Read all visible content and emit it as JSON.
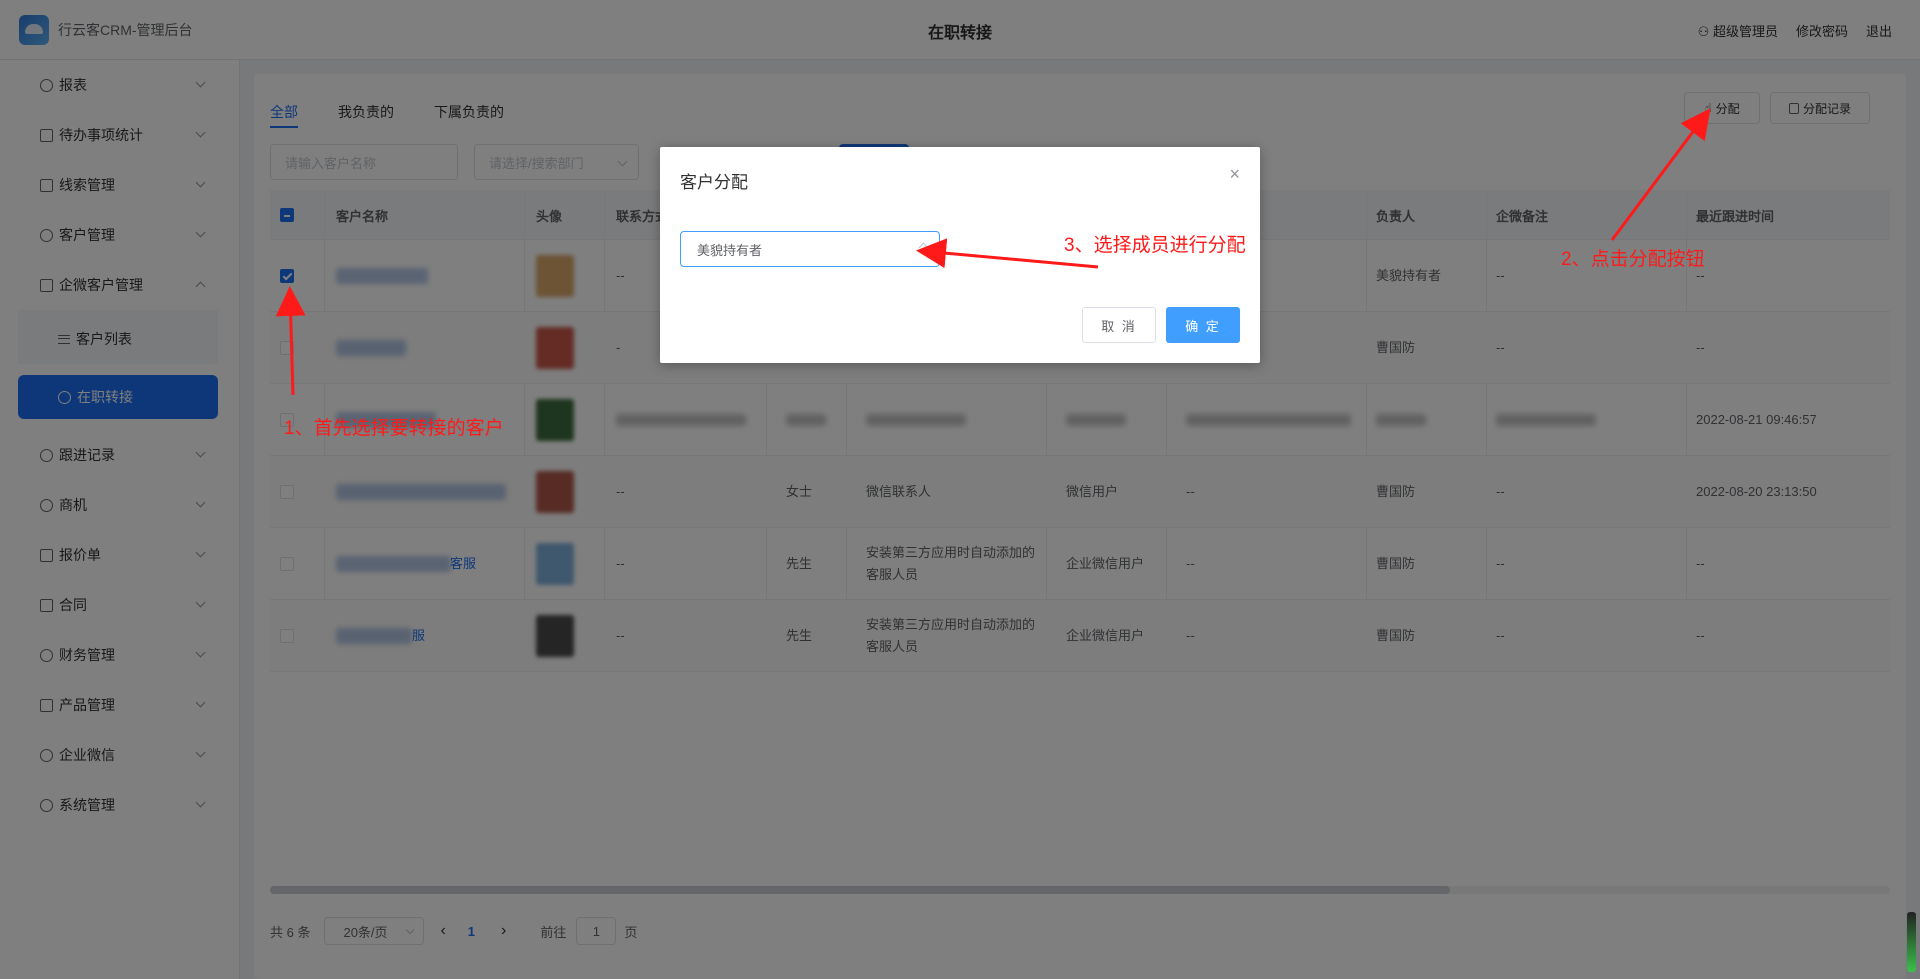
{
  "header": {
    "app_title": "行云客CRM-管理后台",
    "page_title": "在职转接",
    "user_label": "超级管理员",
    "change_password": "修改密码",
    "logout": "退出"
  },
  "sidebar": {
    "items": [
      {
        "label": "报表"
      },
      {
        "label": "待办事项统计"
      },
      {
        "label": "线索管理"
      },
      {
        "label": "客户管理"
      },
      {
        "label": "企微客户管理"
      },
      {
        "label": "跟进记录"
      },
      {
        "label": "商机"
      },
      {
        "label": "报价单"
      },
      {
        "label": "合同"
      },
      {
        "label": "财务管理"
      },
      {
        "label": "产品管理"
      },
      {
        "label": "企业微信"
      },
      {
        "label": "系统管理"
      }
    ],
    "sub_items": [
      {
        "label": "客户列表"
      },
      {
        "label": "在职转接"
      }
    ]
  },
  "tabs": [
    {
      "label": "全部"
    },
    {
      "label": "我负责的"
    },
    {
      "label": "下属负责的"
    }
  ],
  "toolbar": {
    "assign_label": "分配",
    "assign_records_label": "分配记录"
  },
  "filters": {
    "customer_name_placeholder": "请输入客户名称",
    "department_placeholder": "请选择/搜索部门"
  },
  "table": {
    "headers": [
      "客户名称",
      "头像",
      "联系方式",
      "负责人",
      "企微备注",
      "最近跟进时间"
    ],
    "rows": [
      {
        "checked": true,
        "contact": "--",
        "gender": "",
        "source": "",
        "type": "",
        "remark": "",
        "owner": "美貌持有者",
        "note": "--",
        "last_follow": "--"
      },
      {
        "checked": false,
        "contact": "-",
        "gender": "",
        "source": "",
        "type": "",
        "remark": "",
        "owner": "曹国防",
        "note": "--",
        "last_follow": "--"
      },
      {
        "checked": false,
        "contact": "",
        "gender": "",
        "source": "",
        "type": "",
        "remark": "",
        "owner": "",
        "note": "",
        "last_follow": "2022-08-21 09:46:57"
      },
      {
        "checked": false,
        "contact": "--",
        "gender": "女士",
        "source": "微信联系人",
        "type": "微信用户",
        "remark": "--",
        "owner": "曹国防",
        "note": "--",
        "last_follow": "2022-08-20 23:13:50"
      },
      {
        "checked": false,
        "contact": "--",
        "gender": "先生",
        "source": "安装第三方应用时自动添加的客服人员",
        "type": "企业微信用户",
        "remark": "--",
        "owner": "曹国防",
        "note": "--",
        "last_follow": "--"
      },
      {
        "checked": false,
        "contact": "--",
        "gender": "先生",
        "source": "安装第三方应用时自动添加的客服人员",
        "type": "企业微信用户",
        "remark": "--",
        "owner": "曹国防",
        "note": "--",
        "last_follow": "--"
      }
    ],
    "name_suffix_row5": "客服",
    "name_suffix_row6": "服"
  },
  "pagination": {
    "total": "共 6 条",
    "page_size": "20条/页",
    "prev": "‹",
    "current": "1",
    "next": "›",
    "goto_label": "前往",
    "goto_value": "1",
    "page_unit": "页"
  },
  "dialog": {
    "title": "客户分配",
    "close": "×",
    "selected_member": "美貌持有者",
    "cancel_label": "取 消",
    "confirm_label": "确 定"
  },
  "annotations": {
    "step1": "1、首先选择要转接的客户",
    "step2": "2、点击分配按钮",
    "step3": "3、选择成员进行分配",
    "color": "#ff1a1a"
  },
  "colors": {
    "primary": "#1d6ff2",
    "dialog_confirm": "#409eff"
  }
}
